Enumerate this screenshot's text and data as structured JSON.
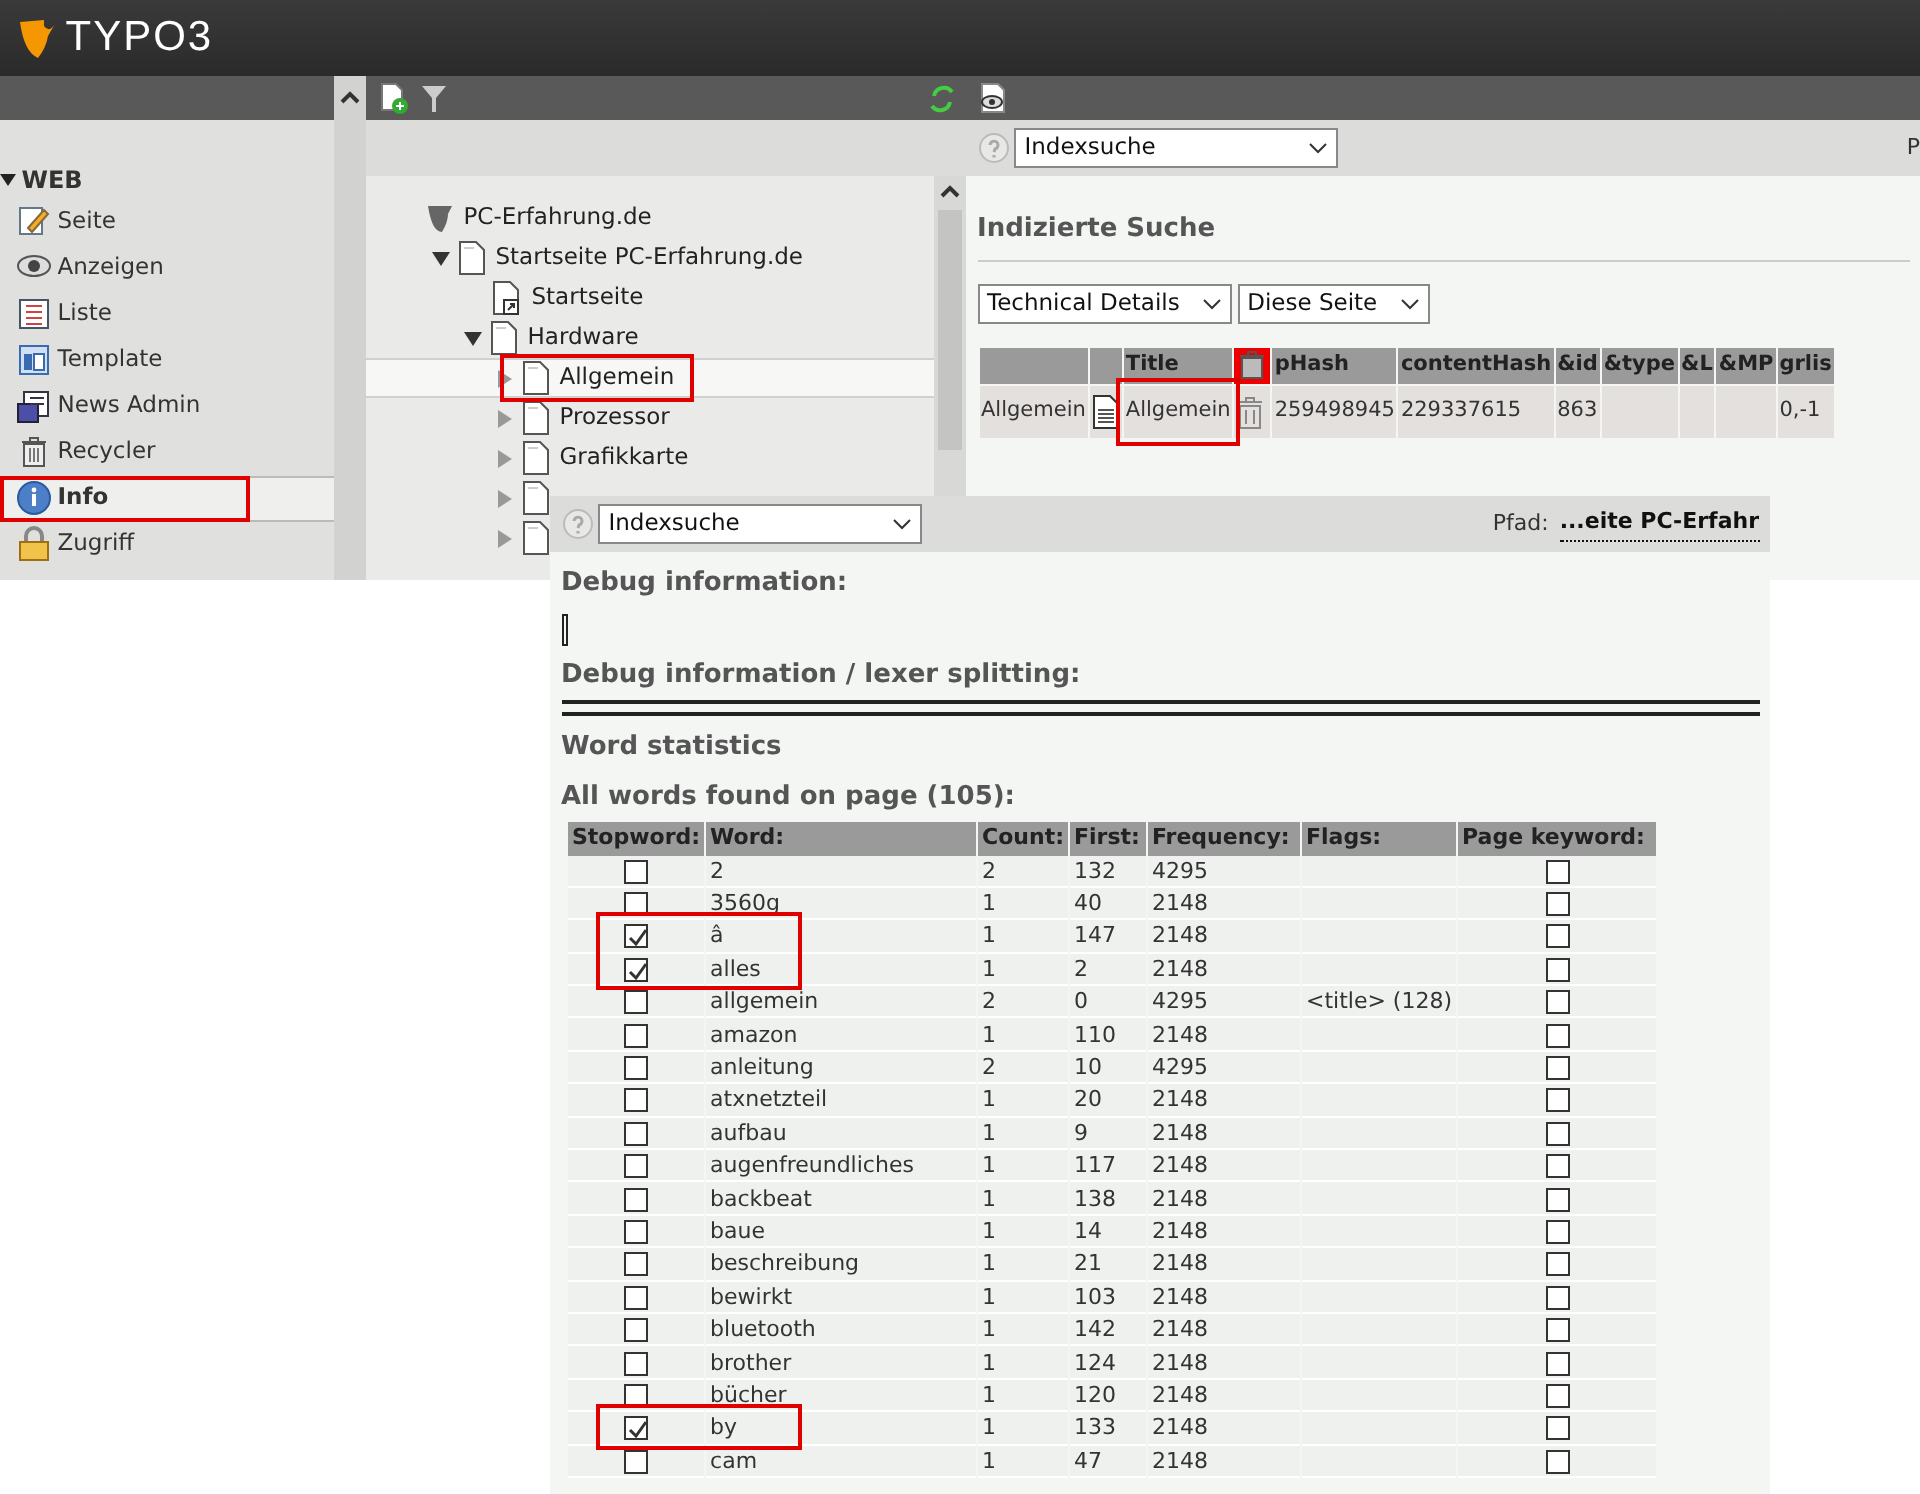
{
  "header": {
    "logo_text": "TYPO3"
  },
  "module_menu": {
    "group": "WEB",
    "expanded": true,
    "items": [
      {
        "label": "Seite",
        "selected": false,
        "highlighted": false
      },
      {
        "label": "Anzeigen",
        "selected": false,
        "highlighted": false
      },
      {
        "label": "Liste",
        "selected": false,
        "highlighted": false
      },
      {
        "label": "Template",
        "selected": false,
        "highlighted": false
      },
      {
        "label": "News Admin",
        "selected": false,
        "highlighted": false
      },
      {
        "label": "Recycler",
        "selected": false,
        "highlighted": false
      },
      {
        "label": "Info",
        "selected": true,
        "highlighted": true
      },
      {
        "label": "Zugriff",
        "selected": false,
        "highlighted": false
      }
    ]
  },
  "page_tree": {
    "nodes": [
      {
        "label": "PC-Erfahrung.de",
        "kind": "root",
        "selected": false,
        "highlighted": false,
        "children": [
          {
            "label": "Startseite PC-Erfahrung.de",
            "kind": "page",
            "expanded": true,
            "selected": false,
            "highlighted": false,
            "children": [
              {
                "label": "Startseite",
                "kind": "shortcut",
                "selected": false,
                "highlighted": false
              },
              {
                "label": "Hardware",
                "kind": "page",
                "expanded": true,
                "selected": false,
                "highlighted": false,
                "children": [
                  {
                    "label": "Allgemein",
                    "kind": "page",
                    "expanded": false,
                    "selected": true,
                    "highlighted": true
                  },
                  {
                    "label": "Prozessor",
                    "kind": "page",
                    "expanded": false,
                    "selected": false,
                    "highlighted": false
                  },
                  {
                    "label": "Grafikkarte",
                    "kind": "page",
                    "expanded": false,
                    "selected": false,
                    "highlighted": false
                  },
                  {
                    "kind": "page",
                    "expanded": false,
                    "selected": false
                  },
                  {
                    "kind": "page",
                    "expanded": false,
                    "selected": false
                  }
                ]
              }
            ]
          }
        ]
      }
    ]
  },
  "content": {
    "module_select": "Indexsuche",
    "path_label": "P",
    "heading": "Indizierte Suche",
    "selects": [
      "Technical Details",
      "Diese Seite"
    ],
    "table": {
      "columns": [
        {
          "kind": "blank"
        },
        {
          "kind": "blank"
        },
        {
          "kind": "text",
          "label": "Title"
        },
        {
          "kind": "delete"
        },
        {
          "kind": "text",
          "label": "pHash"
        },
        {
          "kind": "text",
          "label": "contentHash"
        },
        {
          "kind": "text",
          "label": "&id"
        },
        {
          "kind": "text",
          "label": "&type"
        },
        {
          "kind": "text",
          "label": "&L"
        },
        {
          "kind": "text",
          "label": "&MP"
        },
        {
          "kind": "text",
          "label": "grlis"
        }
      ],
      "rows": [
        [
          {
            "kind": "text",
            "text": "Allgemein"
          },
          {
            "kind": "doc"
          },
          {
            "kind": "text",
            "text": "Allgemein",
            "highlighted": true
          },
          {
            "kind": "delete"
          },
          {
            "kind": "text",
            "text": "259498945"
          },
          {
            "kind": "text",
            "text": "229337615"
          },
          {
            "kind": "text",
            "text": "863"
          },
          {
            "kind": "blank"
          },
          {
            "kind": "blank"
          },
          {
            "kind": "blank"
          },
          {
            "kind": "text",
            "text": "0,-1"
          }
        ]
      ]
    }
  },
  "overlay": {
    "module_select": "Indexsuche",
    "path_label": "Pfad:",
    "path_link": "...eite PC-Erfahr",
    "debug_heading": "Debug information:",
    "lexer_heading": "Debug information / lexer splitting:",
    "stats_heading": "Word statistics",
    "words_heading": "All words found on page (105):",
    "word_table": {
      "columns": [
        "Stopword:",
        "Word:",
        "Count:",
        "First:",
        "Frequency:",
        "Flags:",
        "Page keyword:"
      ],
      "rows": [
        {
          "stopword": false,
          "word": "2",
          "count": "2",
          "first": "132",
          "frequency": "4295",
          "page_keyword": false,
          "highlighted": false
        },
        {
          "stopword": false,
          "word": "3560g",
          "count": "1",
          "first": "40",
          "frequency": "2148",
          "page_keyword": false,
          "highlighted": false
        },
        {
          "stopword": true,
          "word": "â",
          "count": "1",
          "first": "147",
          "frequency": "2148",
          "page_keyword": false,
          "highlighted": true
        },
        {
          "stopword": true,
          "word": "alles",
          "count": "1",
          "first": "2",
          "frequency": "2148",
          "page_keyword": false,
          "highlighted": true
        },
        {
          "stopword": false,
          "word": "allgemein",
          "count": "2",
          "first": "0",
          "frequency": "4295",
          "flags": "<title> (128)",
          "page_keyword": false,
          "highlighted": false
        },
        {
          "stopword": false,
          "word": "amazon",
          "count": "1",
          "first": "110",
          "frequency": "2148",
          "page_keyword": false,
          "highlighted": false
        },
        {
          "stopword": false,
          "word": "anleitung",
          "count": "2",
          "first": "10",
          "frequency": "4295",
          "page_keyword": false,
          "highlighted": false
        },
        {
          "stopword": false,
          "word": "atxnetzteil",
          "count": "1",
          "first": "20",
          "frequency": "2148",
          "page_keyword": false,
          "highlighted": false
        },
        {
          "stopword": false,
          "word": "aufbau",
          "count": "1",
          "first": "9",
          "frequency": "2148",
          "page_keyword": false,
          "highlighted": false
        },
        {
          "stopword": false,
          "word": "augenfreundliches",
          "count": "1",
          "first": "117",
          "frequency": "2148",
          "page_keyword": false,
          "highlighted": false
        },
        {
          "stopword": false,
          "word": "backbeat",
          "count": "1",
          "first": "138",
          "frequency": "2148",
          "page_keyword": false,
          "highlighted": false
        },
        {
          "stopword": false,
          "word": "baue",
          "count": "1",
          "first": "14",
          "frequency": "2148",
          "page_keyword": false,
          "highlighted": false
        },
        {
          "stopword": false,
          "word": "beschreibung",
          "count": "1",
          "first": "21",
          "frequency": "2148",
          "page_keyword": false,
          "highlighted": false
        },
        {
          "stopword": false,
          "word": "bewirkt",
          "count": "1",
          "first": "103",
          "frequency": "2148",
          "page_keyword": false,
          "highlighted": false
        },
        {
          "stopword": false,
          "word": "bluetooth",
          "count": "1",
          "first": "142",
          "frequency": "2148",
          "page_keyword": false,
          "highlighted": false
        },
        {
          "stopword": false,
          "word": "brother",
          "count": "1",
          "first": "124",
          "frequency": "2148",
          "page_keyword": false,
          "highlighted": false
        },
        {
          "stopword": false,
          "word": "bücher",
          "count": "1",
          "first": "120",
          "frequency": "2148",
          "page_keyword": false,
          "highlighted": false
        },
        {
          "stopword": true,
          "word": "by",
          "count": "1",
          "first": "133",
          "frequency": "2148",
          "page_keyword": false,
          "highlighted": true
        },
        {
          "stopword": false,
          "word": "cam",
          "count": "1",
          "first": "47",
          "frequency": "2148",
          "page_keyword": false,
          "highlighted": false
        }
      ]
    }
  }
}
